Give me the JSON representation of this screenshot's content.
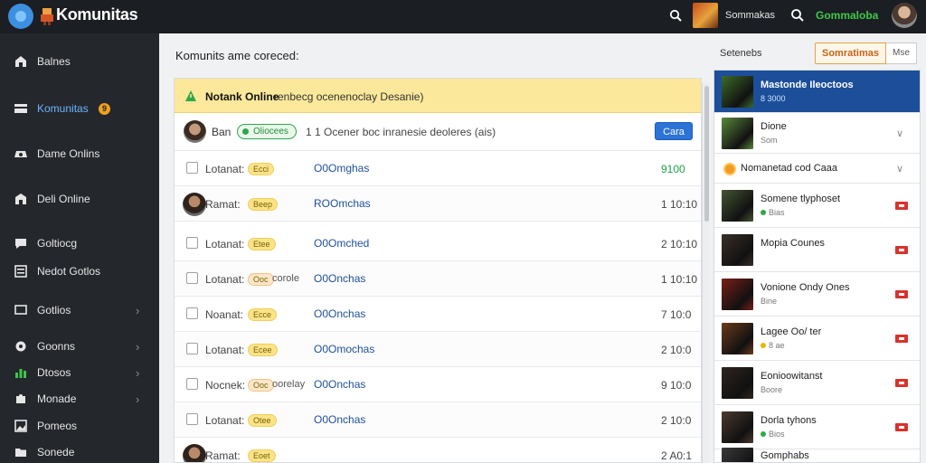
{
  "app": {
    "title": "Komunitas",
    "top_label": "Sommakas",
    "top_green_label": "Gommaloba"
  },
  "sidebar": {
    "items": [
      {
        "label": "Balnes",
        "icon": "home-icon"
      },
      {
        "label": "Komunitas",
        "icon": "community-icon",
        "badge": "9"
      },
      {
        "label": "Dame Onlins",
        "icon": "game-icon"
      },
      {
        "label": "Deli Online",
        "icon": "store-icon"
      },
      {
        "label": "Goltiocg",
        "icon": "chat-icon"
      },
      {
        "label": "Nedot Gotlos",
        "icon": "list-icon"
      },
      {
        "label": "Gotlios",
        "icon": "monitor-icon"
      },
      {
        "label": "Goonns",
        "icon": "settings-icon"
      },
      {
        "label": "Dtosos",
        "icon": "bar-chart-icon"
      },
      {
        "label": "Monade",
        "icon": "puzzle-icon"
      },
      {
        "label": "Pomeos",
        "icon": "image-icon"
      },
      {
        "label": "Sonede",
        "icon": "folder-icon"
      }
    ]
  },
  "main": {
    "title": "Komunits ame coreced:",
    "banner": {
      "strong": "Notank Online",
      "text": "renbecg ocenenoclay Desanie)"
    },
    "filter": {
      "name": "Ban",
      "pill": "Oliocees",
      "text": "1 1 Ocener boc inranesie deoleres (ais)",
      "button": "Cara"
    },
    "rows": [
      {
        "name": "Lotanat:",
        "tag": "Ecci",
        "link": "O0Omghas",
        "num": "9100",
        "check": true
      },
      {
        "name": "Ramat:",
        "tag": "Beep",
        "link": "ROOmchas",
        "num": "1 10:10",
        "avatar": true
      },
      {
        "name": "Lotanat:",
        "tag": "Etee",
        "link": "O0Omched",
        "num": "2 10:10",
        "check": true
      },
      {
        "name": "Lotanat:",
        "tag": "Ooc",
        "extra": "corole",
        "link": "O0Onchas",
        "num": "1 10:10",
        "check": true,
        "tag_alt": true
      },
      {
        "name": "Noanat:",
        "tag": "Ecce",
        "link": "O0Onchas",
        "num": "7 10:0",
        "check": true
      },
      {
        "name": "Lotanat:",
        "tag": "Ecee",
        "link": "O0Omochas",
        "num": "2 10:0",
        "check": true
      },
      {
        "name": "Nocnek:",
        "tag": "Ooc",
        "extra": "oorelay",
        "link": "O0Onchas",
        "num": "9 10:0",
        "check": true,
        "tag_alt": true
      },
      {
        "name": "Lotanat:",
        "tag": "Otee",
        "link": "O0Onchas",
        "num": "2 10:0",
        "check": true
      },
      {
        "name": "Ramat:",
        "tag": "Eoet",
        "link": "",
        "num": "2 A0:1",
        "avatar": true
      }
    ]
  },
  "right": {
    "label": "Setenebs",
    "button": "Somratimas",
    "button2": "Mse",
    "items": [
      {
        "title": "Mastonde Ileoctoos",
        "sub": "8 3000",
        "active": true,
        "thumb": "#3d6b2a"
      },
      {
        "title": "Dione",
        "sub": "Som",
        "chev": true,
        "thumb": "#5a8a3a"
      },
      {
        "title": "Nomanetad cod Caaa",
        "coin": true,
        "chev": true
      },
      {
        "title": "Somene tlyphoset",
        "sub": "Bias",
        "flag": true,
        "thumb": "#445533",
        "dot": "g"
      },
      {
        "title": "Mopia Counes",
        "sub": "",
        "flag": true,
        "thumb": "#3a2e28"
      },
      {
        "title": "Vonione Ondy Ones",
        "sub": "Bine",
        "flag": true,
        "thumb": "#7a1f18"
      },
      {
        "title": "Lagee Oo/ ter",
        "sub": "8 ae",
        "flag": true,
        "thumb": "#6b3a1a",
        "dot": "y"
      },
      {
        "title": "Eonioowitanst",
        "sub": "Boore",
        "flag": true,
        "thumb": "#2f241e"
      },
      {
        "title": "Dorla tyhons",
        "sub": "Bios",
        "flag": true,
        "thumb": "#4a3a2e",
        "dot": "g"
      },
      {
        "title": "Gomphabs",
        "sub": "",
        "flag": false,
        "thumb": "#3a3a3a"
      }
    ]
  }
}
